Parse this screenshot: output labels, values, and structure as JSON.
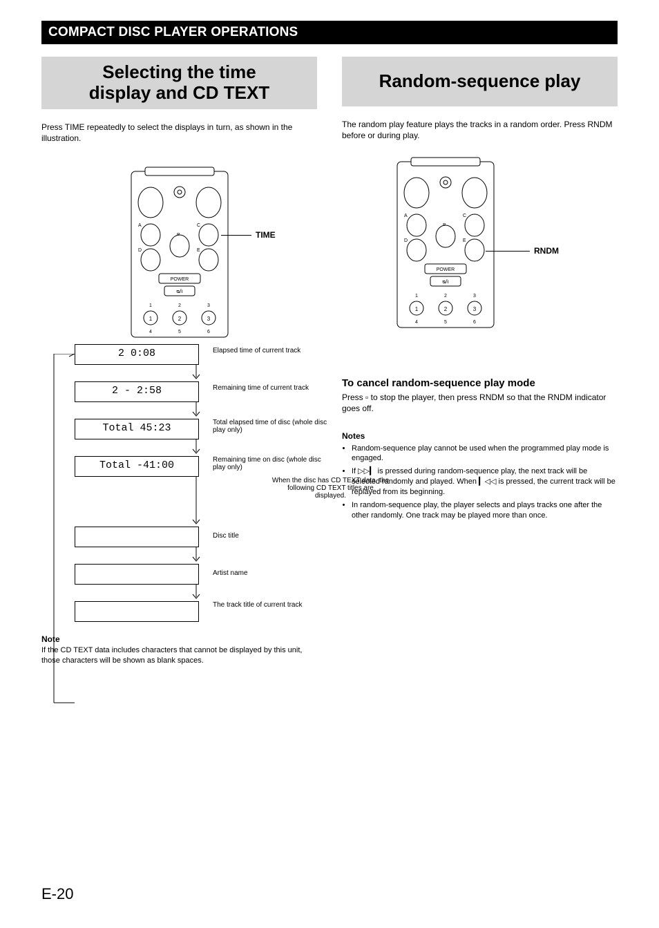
{
  "header": {
    "section_title": "COMPACT DISC PLAYER OPERATIONS"
  },
  "left": {
    "title_l1": "Selecting the time",
    "title_l2": "display and CD TEXT",
    "intro": "Press TIME repeatedly to select the displays in turn, as shown in the illustration.",
    "remote": {
      "callout": "TIME",
      "labels": {
        "a": "A",
        "b": "B",
        "c": "C",
        "d": "D",
        "e": "E",
        "power": "POWER",
        "pwrsym": "ᴓ/I",
        "n1": "1",
        "n2": "2",
        "n3": "3",
        "n4": "4",
        "n5": "5",
        "n6": "6"
      }
    },
    "flow": {
      "d1": "2    0:08",
      "l1": "Elapsed time of current track",
      "d2": "2  - 2:58",
      "l2": "Remaining time of current track",
      "d3": "Total  45:23",
      "l3": "Total elapsed time of disc (whole disc play only)",
      "d4": "Total -41:00",
      "l4": "Remaining time on disc (whole disc play only)",
      "l5": "When the disc has CD TEXT data, the following CD TEXT titles are displayed.",
      "d5": "",
      "l5b": "Disc title",
      "d6": "",
      "l6": "Artist name",
      "d7": "",
      "l7": "The track title of current track"
    },
    "note_hd": "Note",
    "note_body": "If the CD TEXT data includes characters that cannot be displayed by this unit, those characters will be shown as blank spaces."
  },
  "right": {
    "title": "Random-sequence play",
    "intro": "The random play feature plays the tracks in a random order. Press RNDM before or during play.",
    "remote": {
      "callout": "RNDM",
      "labels": {
        "a": "A",
        "b": "B",
        "c": "C",
        "d": "D",
        "e": "E",
        "power": "POWER",
        "pwrsym": "ᴓ/I",
        "n1": "1",
        "n2": "2",
        "n3": "3",
        "n4": "4",
        "n5": "5",
        "n6": "6"
      }
    },
    "cancel_hd": "To cancel random-sequence play mode",
    "cancel_body": "Press ▫ to stop the player, then press RNDM so that the RNDM indicator goes off.",
    "notes_hd": "Notes",
    "notes": {
      "n1": "Random-sequence play cannot be used when the programmed play mode is engaged.",
      "n2_a": "If ",
      "n2_sym": "▷▷▎",
      "n2_b": " is pressed during random-sequence play, the next track will be selected randomly and played. When ",
      "n2_sym2": "▎◁◁",
      "n2_c": " is pressed, the current track will be replayed from its beginning.",
      "n3": "In random-sequence play, the player selects and plays tracks one after the other randomly. One track may be played more than once."
    }
  },
  "page_number": "E-20"
}
